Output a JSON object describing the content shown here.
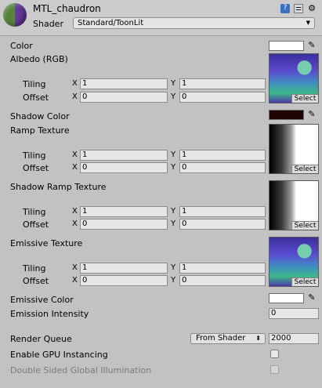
{
  "header": {
    "material_name": "MTL_chaudron",
    "shader_label": "Shader",
    "shader_value": "Standard/ToonLit",
    "icons": [
      "help-icon",
      "settings-icon"
    ]
  },
  "properties": {
    "color_label": "Color",
    "color_value": "#ffffff",
    "albedo_label": "Albedo (RGB)",
    "shadow_color_label": "Shadow Color",
    "shadow_color_value": "#1e0606",
    "ramp_texture_label": "Ramp Texture",
    "shadow_ramp_label": "Shadow Ramp Texture",
    "emissive_texture_label": "Emissive Texture",
    "emissive_color_label": "Emissive Color",
    "emissive_color_value": "#ffffff",
    "emission_intensity_label": "Emission Intensity",
    "emission_intensity_value": "0",
    "tiling_label": "Tiling",
    "offset_label": "Offset",
    "x_label": "X",
    "y_label": "Y",
    "select_label": "Select"
  },
  "textures": [
    {
      "tiling_x": "1",
      "tiling_y": "1",
      "offset_x": "0",
      "offset_y": "0"
    },
    {
      "tiling_x": "1",
      "tiling_y": "1",
      "offset_x": "0",
      "offset_y": "0"
    },
    {
      "tiling_x": "1",
      "tiling_y": "1",
      "offset_x": "0",
      "offset_y": "0"
    },
    {
      "tiling_x": "1",
      "tiling_y": "1",
      "offset_x": "0",
      "offset_y": "0"
    }
  ],
  "settings": {
    "render_queue_label": "Render Queue",
    "render_queue_mode": "From Shader",
    "render_queue_value": "2000",
    "gpu_instancing_label": "Enable GPU Instancing",
    "double_sided_gi_label": "Double Sided Global Illumination"
  }
}
